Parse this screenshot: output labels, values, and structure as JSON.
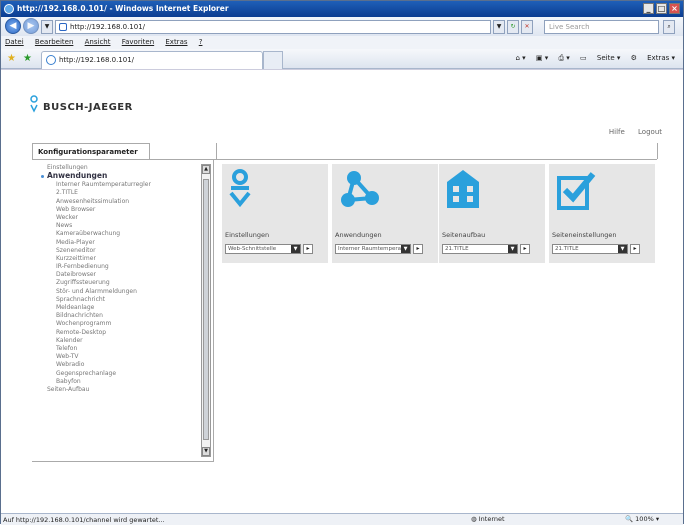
{
  "window": {
    "title": "http://192.168.0.101/ - Windows Internet Explorer"
  },
  "address": {
    "url": "http://192.168.0.101/",
    "search_placeholder": "Live Search"
  },
  "menu": [
    "Datei",
    "Bearbeiten",
    "Ansicht",
    "Favoriten",
    "Extras",
    "?"
  ],
  "tab": {
    "title": "http://192.168.0.101/"
  },
  "toolbar": {
    "page": "Seite",
    "extras": "Extras"
  },
  "logo": {
    "text": "BUSCH-JAEGER"
  },
  "toplinks": {
    "help": "Hilfe",
    "logout": "Logout"
  },
  "panel": {
    "tab_label": "Konfigurationsparameter"
  },
  "tree": {
    "top": "Einstellungen",
    "section": "Anwendungen",
    "items": [
      "Interner Raumtemperaturregler",
      "2.TITLE",
      "Anwesenheitssimulation",
      "Web Browser",
      "Wecker",
      "News",
      "Kameraüberwachung",
      "Media-Player",
      "Szeneneditor",
      "Kurzzeittimer",
      "IR-Fernbedienung",
      "Dateibrowser",
      "Zugriffssteuerung",
      "Stör- und Alarmmeldungen",
      "Sprachnachricht",
      "Meldeanlage",
      "Bildnachrichten",
      "Wochenprogramm",
      "Remote-Desktop",
      "Kalender",
      "Telefon",
      "Web-TV",
      "Webradio",
      "Gegensprechanlage",
      "Babyfon"
    ],
    "bottom": "Seiten-Aufbau"
  },
  "cards": [
    {
      "label": "Einstellungen",
      "select": "Web-Schnittstelle",
      "icon": "settings-icon"
    },
    {
      "label": "Anwendungen",
      "select": "Interner Raumtempera",
      "icon": "applications-icon"
    },
    {
      "label": "Seitenaufbau",
      "select": "21.TITLE",
      "icon": "building-icon"
    },
    {
      "label": "Seiteneinstellungen",
      "select": "21.TITLE",
      "icon": "page-settings-icon"
    }
  ],
  "status": {
    "text": "Auf http://192.168.0.101/channel wird gewartet...",
    "zone": "Internet",
    "zoom": "100%"
  },
  "colors": {
    "accent": "#2aa0dc",
    "titlebar": "#0b3d91"
  }
}
